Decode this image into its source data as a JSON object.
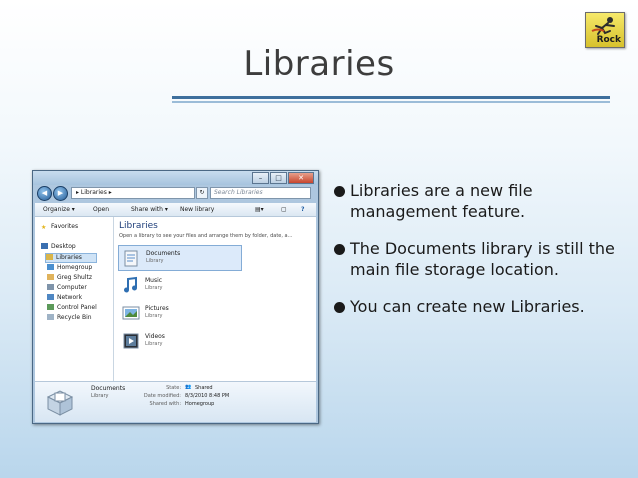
{
  "slide": {
    "title": "Libraries",
    "logo_text": "Rock",
    "bullets": [
      "Libraries are a new file management feature.",
      "The Documents library is still the main file storage location.",
      "You can create new Libraries."
    ]
  },
  "explorer": {
    "address_path": "▸ Libraries ▸",
    "search_placeholder": "Search Libraries",
    "toolbar": {
      "organize": "Organize ▾",
      "open": "Open",
      "share_with": "Share with ▾",
      "new_library": "New library"
    },
    "nav": {
      "favorites": "Favorites",
      "desktop": "Desktop",
      "libraries": "Libraries",
      "homegroup": "Homegroup",
      "user": "Greg Shultz",
      "computer": "Computer",
      "network": "Network",
      "control_panel": "Control Panel",
      "recycle_bin": "Recycle Bin"
    },
    "content": {
      "title": "Libraries",
      "subtitle": "Open a library to see your files and arrange them by folder, date, a...",
      "items": [
        {
          "name": "Documents",
          "type": "Library"
        },
        {
          "name": "Music",
          "type": "Library"
        },
        {
          "name": "Pictures",
          "type": "Library"
        },
        {
          "name": "Videos",
          "type": "Library"
        }
      ]
    },
    "details": {
      "name": "Documents",
      "type": "Library",
      "state_label": "State:",
      "state_value": "Shared",
      "modified_label": "Date modified:",
      "modified_value": "8/3/2010 8:48 PM",
      "shared_label": "Shared with:",
      "shared_value": "Homegroup"
    }
  },
  "colors": {
    "title_rule": "#3e6f9d",
    "library_title": "#1e3e7a",
    "selection": "#dceafa"
  }
}
